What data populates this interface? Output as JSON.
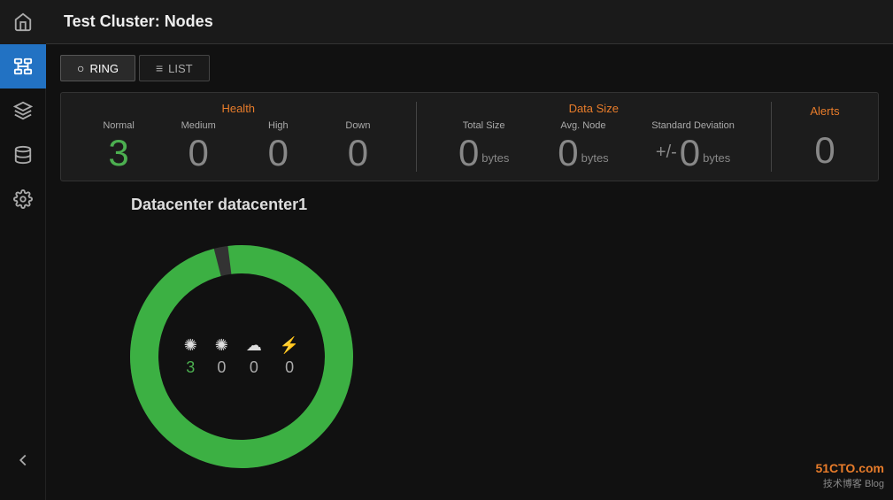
{
  "header": {
    "cluster_label": "Test Cluster: ",
    "page_title": "Nodes"
  },
  "tabs": [
    {
      "id": "ring",
      "label": "RING",
      "icon": "○",
      "active": true
    },
    {
      "id": "list",
      "label": "LIST",
      "icon": "≡",
      "active": false
    }
  ],
  "stats": {
    "health_section": {
      "title": "Health",
      "columns": [
        {
          "label": "Normal",
          "value": "3",
          "green": true
        },
        {
          "label": "Medium",
          "value": "0",
          "green": false
        },
        {
          "label": "High",
          "value": "0",
          "green": false
        },
        {
          "label": "Down",
          "value": "0",
          "green": false
        }
      ]
    },
    "data_size_section": {
      "title": "Data Size",
      "columns": [
        {
          "label": "Total Size",
          "value": "0",
          "unit": "bytes"
        },
        {
          "label": "Avg. Node",
          "value": "0",
          "unit": "bytes"
        },
        {
          "label": "Standard Deviation",
          "value": "0",
          "unit": "bytes",
          "prefix": "+/-"
        }
      ]
    },
    "alerts_section": {
      "title": "Alerts",
      "value": "0"
    }
  },
  "ring": {
    "datacenter_label": "Datacenter datacenter1",
    "icons": [
      {
        "icon": "✺",
        "value": "3",
        "green": true
      },
      {
        "icon": "✺",
        "value": "0",
        "green": false
      },
      {
        "icon": "☁",
        "value": "0",
        "green": false
      },
      {
        "icon": "⚡",
        "value": "0",
        "green": false
      }
    ]
  },
  "sidebar": {
    "items": [
      {
        "id": "home",
        "icon": "home"
      },
      {
        "id": "nodes",
        "icon": "nodes",
        "active": true
      },
      {
        "id": "layers",
        "icon": "layers"
      },
      {
        "id": "database",
        "icon": "database"
      },
      {
        "id": "settings",
        "icon": "settings"
      }
    ]
  },
  "watermark": {
    "site": "51CTO.com",
    "subtitle": "技术博客  Blog"
  }
}
